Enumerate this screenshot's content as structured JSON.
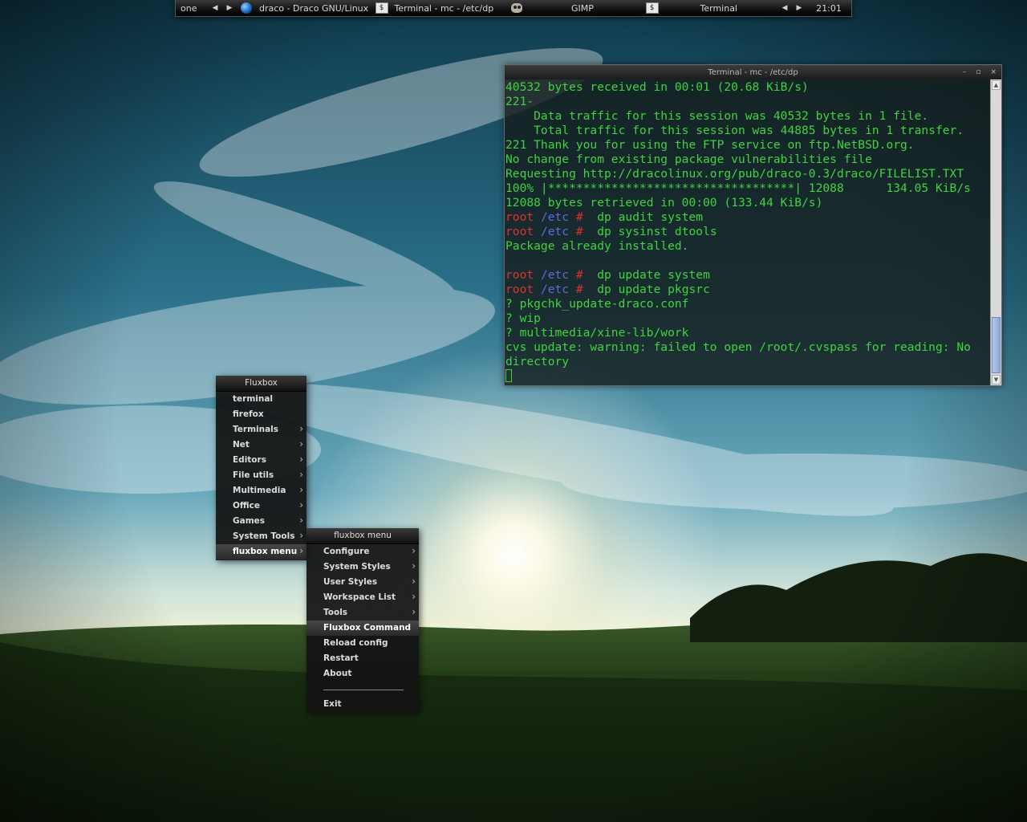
{
  "colors": {
    "terminal_text": "#3fd43f",
    "prompt_user": "#d93434",
    "prompt_dir": "#5a6de0",
    "menu_bg": "#121212",
    "toolbar_bg": "#111111"
  },
  "toolbar": {
    "workspace": "one",
    "prev_workspace_icon": "triangle-left-icon",
    "next_workspace_icon": "triangle-right-icon",
    "tasks": [
      {
        "label": "draco - Draco GNU/Linux",
        "icon": "globe-icon"
      },
      {
        "label": "Terminal - mc - /etc/dp",
        "icon": "terminal-icon"
      },
      {
        "label": "GIMP",
        "icon": "gimp-icon"
      },
      {
        "label": "Terminal",
        "icon": "terminal-icon"
      }
    ],
    "clock": "21:01"
  },
  "terminal": {
    "title": "Terminal - mc - /etc/dp",
    "buttons": {
      "minimize": "–",
      "maximize": "▫",
      "close": "×"
    },
    "lines": [
      {
        "text": "40532 bytes received in 00:01 (20.68 KiB/s)"
      },
      {
        "text": "221-"
      },
      {
        "text": "    Data traffic for this session was 40532 bytes in 1 file."
      },
      {
        "text": "    Total traffic for this session was 44885 bytes in 1 transfer."
      },
      {
        "text": "221 Thank you for using the FTP service on ftp.NetBSD.org."
      },
      {
        "text": "No change from existing package vulnerabilities file"
      },
      {
        "text": "Requesting http://dracolinux.org/pub/draco-0.3/draco/FILELIST.TXT"
      },
      {
        "text": "100% |***********************************| 12088      134.05 KiB/s"
      },
      {
        "text": "12088 bytes retrieved in 00:00 (133.44 KiB/s)"
      },
      {
        "prompt": {
          "user": "root",
          "dir": "/etc",
          "hash": "#"
        },
        "text": "  dp audit system"
      },
      {
        "prompt": {
          "user": "root",
          "dir": "/etc",
          "hash": "#"
        },
        "text": "  dp sysinst dtools"
      },
      {
        "text": "Package already installed."
      },
      {
        "text": ""
      },
      {
        "prompt": {
          "user": "root",
          "dir": "/etc",
          "hash": "#"
        },
        "text": "  dp update system"
      },
      {
        "prompt": {
          "user": "root",
          "dir": "/etc",
          "hash": "#"
        },
        "text": "  dp update pkgsrc"
      },
      {
        "text": "? pkgchk_update-draco.conf"
      },
      {
        "text": "? wip"
      },
      {
        "text": "? multimedia/xine-lib/work"
      },
      {
        "text": "cvs update: warning: failed to open /root/.cvspass for reading: No"
      },
      {
        "text": "directory"
      }
    ]
  },
  "menu_main": {
    "title": "Fluxbox",
    "items": [
      {
        "label": "terminal",
        "submenu": false
      },
      {
        "label": "firefox",
        "submenu": false
      },
      {
        "label": "Terminals",
        "submenu": true
      },
      {
        "label": "Net",
        "submenu": true
      },
      {
        "label": "Editors",
        "submenu": true
      },
      {
        "label": "File utils",
        "submenu": true
      },
      {
        "label": "Multimedia",
        "submenu": true
      },
      {
        "label": "Office",
        "submenu": true
      },
      {
        "label": "Games",
        "submenu": true
      },
      {
        "label": "System Tools",
        "submenu": true
      },
      {
        "label": "fluxbox menu",
        "submenu": true,
        "active": true
      }
    ]
  },
  "menu_sub": {
    "title": "fluxbox menu",
    "items": [
      {
        "label": "Configure",
        "submenu": true
      },
      {
        "label": "System Styles",
        "submenu": true
      },
      {
        "label": "User Styles",
        "submenu": true
      },
      {
        "label": "Workspace List",
        "submenu": true
      },
      {
        "label": "Tools",
        "submenu": true
      },
      {
        "label": "Fluxbox Command",
        "submenu": false,
        "active": true
      },
      {
        "label": "Reload config",
        "submenu": false
      },
      {
        "label": "Restart",
        "submenu": false
      },
      {
        "label": "About",
        "submenu": false
      },
      {
        "separator": true
      },
      {
        "label": "Exit",
        "submenu": false
      }
    ]
  }
}
